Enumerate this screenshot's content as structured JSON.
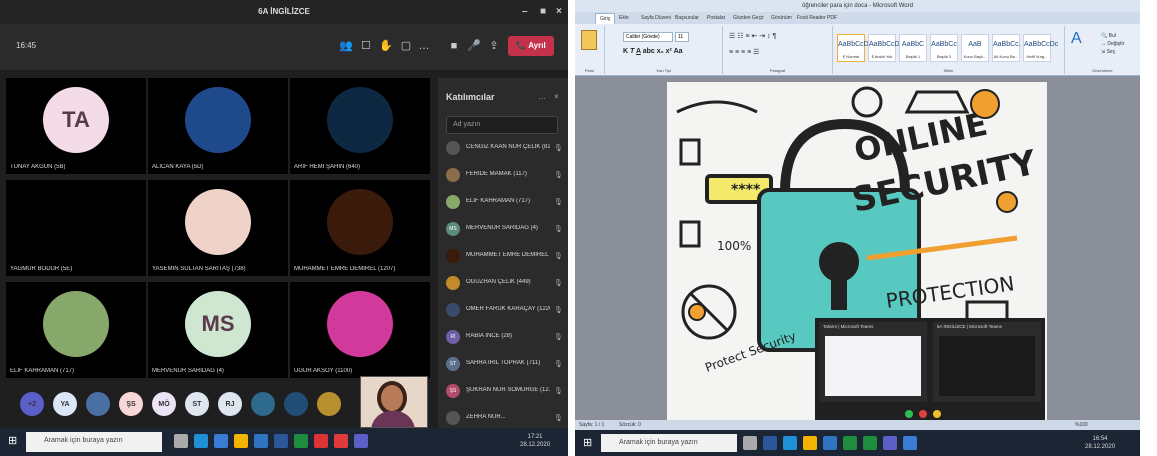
{
  "teams": {
    "window_title": "6A İNGİLİZCE",
    "call_time": "16:45",
    "leave_label": "Ayrıl",
    "tiles": [
      {
        "name": "TUNAY AKGÜN (5B)",
        "initials": "TA",
        "bg": "#f3dce8"
      },
      {
        "name": "ALİCAN KAYA (5D)",
        "initials": "",
        "bg": "#1e4a8c"
      },
      {
        "name": "ARİF HEMİ ŞAHİN (640)",
        "initials": "",
        "bg": "#0b2840"
      },
      {
        "name": "YAĞMUR BODUR (5E)",
        "initials": "",
        "bg": "#000000"
      },
      {
        "name": "YASEMİN SULTAN SARITAŞ (738)",
        "initials": "",
        "bg": "#efd2c8"
      },
      {
        "name": "MUHAMMET EMRE DEMİREL (1207)",
        "initials": "",
        "bg": "#3a1a0a"
      },
      {
        "name": "ELİF KAHRAMAN (717)",
        "initials": "",
        "bg": "#87a86b"
      },
      {
        "name": "MERVENUR SARIDAĞ (4)",
        "initials": "MS",
        "bg": "#cfe7d1"
      },
      {
        "name": "UĞUR AKSOY (1100)",
        "initials": "",
        "bg": "#d1399a"
      }
    ],
    "bottom_avatars": [
      {
        "label": "+2",
        "bg": "#5b5fc7"
      },
      {
        "label": "YA",
        "bg": "#dbe6f6"
      },
      {
        "label": "",
        "bg": "#4a6fa5"
      },
      {
        "label": "ŞS",
        "bg": "#f7d7d7"
      },
      {
        "label": "MÖ",
        "bg": "#ece4f5"
      },
      {
        "label": "ST",
        "bg": "#e0e6ef"
      },
      {
        "label": "RJ",
        "bg": "#e0e6ef"
      },
      {
        "label": "",
        "bg": "#2d6a8c"
      },
      {
        "label": "",
        "bg": "#204d74"
      },
      {
        "label": "",
        "bg": "#b88f2e"
      }
    ],
    "participants": {
      "title": "Katılımcılar",
      "search_placeholder": "Ad yazın",
      "items": [
        {
          "name": "CENGİZ KAAN NUR ÇELİK (823)",
          "initials": "",
          "bg": "#555"
        },
        {
          "name": "FERİDE MAMAK (117)",
          "initials": "",
          "bg": "#8a6d4a"
        },
        {
          "name": "ELİF KAHRAMAN (717)",
          "initials": "",
          "bg": "#87a86b"
        },
        {
          "name": "MERVENUR SARIDAĞ (4)",
          "initials": "MS",
          "bg": "#5b8c7a"
        },
        {
          "name": "MUHAMMET EMRE DEMİREL ...",
          "initials": "",
          "bg": "#3a1a0a"
        },
        {
          "name": "OĞUZHAN ÇELİK (449)",
          "initials": "",
          "bg": "#c48a2a"
        },
        {
          "name": "ÖMER FARUK KARAÇAY (1220)",
          "initials": "",
          "bg": "#3a4a6a"
        },
        {
          "name": "RABİA İNCE (28)",
          "initials": "Rİ",
          "bg": "#6f5fa8"
        },
        {
          "name": "SAHRA IRIL TOPRAK (711)",
          "initials": "ST",
          "bg": "#5b6f8c"
        },
        {
          "name": "ŞÜKRAN NUR SÖMÜRGE (12...",
          "initials": "ŞS",
          "bg": "#b24a6a"
        },
        {
          "name": "ZEHRA NUR...",
          "initials": "",
          "bg": "#555"
        }
      ]
    },
    "taskbar": {
      "search_placeholder": "Aramak için buraya yazın",
      "time": "17:21",
      "date": "28.12.2020"
    }
  },
  "word": {
    "window_title": "öğrenciler para için doca - Microsoft Word",
    "tabs": [
      "Giriş",
      "Ekle",
      "Sayfa Düzeni",
      "Başvurular",
      "Postalar",
      "Gözden Geçir",
      "Görünüm",
      "Foxit Reader PDF"
    ],
    "groups": [
      "Pano",
      "Yazı Tipi",
      "Paragraf",
      "Stiller",
      "Düzenleme"
    ],
    "font_name": "Calibri (Gövde)",
    "font_size": "11",
    "styles": [
      {
        "sample": "AaBbCcDc",
        "name": "¶ Normal"
      },
      {
        "sample": "AaBbCcDc",
        "name": "¶ Aralık Yok"
      },
      {
        "sample": "AaBbC",
        "name": "Başlık 1"
      },
      {
        "sample": "AaBbCc",
        "name": "Başlık 2"
      },
      {
        "sample": "AaB",
        "name": "Konu Başlı..."
      },
      {
        "sample": "AaBbCc.",
        "name": "Alt Konu Ba..."
      },
      {
        "sample": "AaBbCcDc",
        "name": "Hafif Vurg..."
      }
    ],
    "page_text": {
      "line1": "ONLINE",
      "line2": "SECURITY",
      "line3": "PROTECTION",
      "pct": "100%",
      "pwd": "****",
      "protect": "Protect Security"
    },
    "status": {
      "page": "Sayfa: 1 / 1",
      "words": "Sözcük: 0",
      "zoom": "%100"
    },
    "thumbnails": [
      "Takvim | Microsoft Teams",
      "6A İNGİLİZCE | Microsoft Teams"
    ],
    "taskbar": {
      "search_placeholder": "Aramak için buraya yazın",
      "time": "16:54",
      "date": "28.12.2020"
    }
  }
}
